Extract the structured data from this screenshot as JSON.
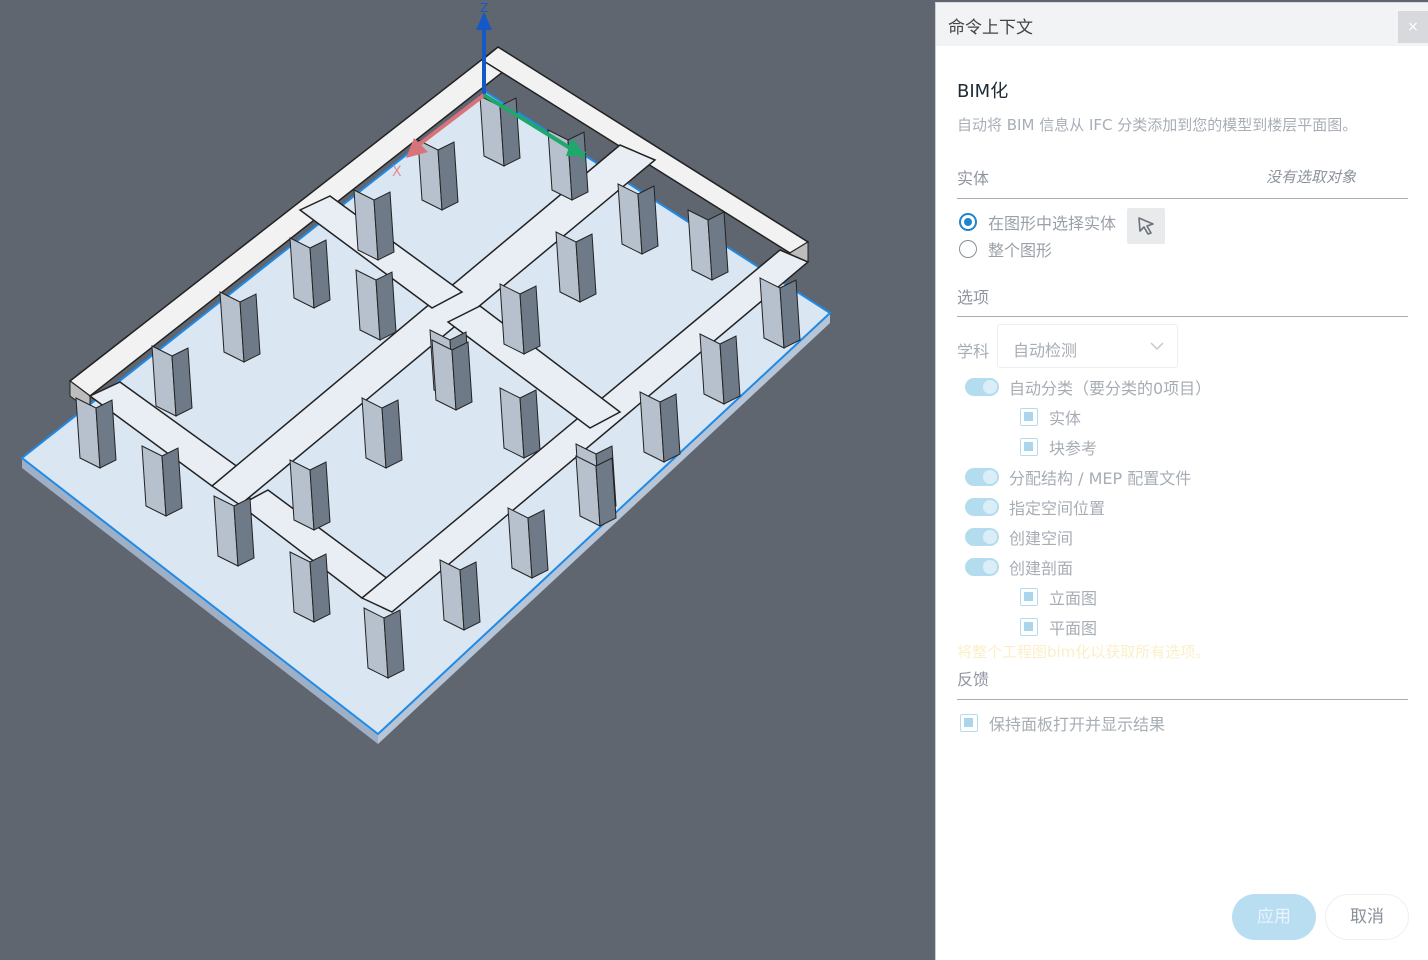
{
  "panel": {
    "header_title": "命令上下文",
    "close_label": "×",
    "title": "BIM化",
    "description": "自动将 BIM 信息从 IFC 分类添加到您的模型到楼层平面图。",
    "entities": {
      "label": "实体",
      "selection_status": "没有选取对象",
      "options": [
        {
          "label": "在图形中选择实体",
          "checked": true
        },
        {
          "label": "整个图形",
          "checked": false
        }
      ]
    },
    "options_section": {
      "label": "选项",
      "discipline_label": "学科",
      "discipline_value": "自动检测",
      "auto_classify": "自动分类（要分类的0项目）",
      "entity": "实体",
      "block_reference": "块参考",
      "assign_profile": "分配结构 / MEP 配置文件",
      "assign_space": "指定空间位置",
      "create_space": "创建空间",
      "create_section": "创建剖面",
      "elevation": "立面图",
      "plan": "平面图",
      "warning": "将整个工程图bim化以获取所有选项。"
    },
    "feedback": {
      "label": "反馈",
      "keep_open": "保持面板打开并显示结果"
    },
    "buttons": {
      "apply": "应用",
      "cancel": "取消"
    }
  },
  "viewport": {
    "axis_x": "X",
    "axis_y": "Y",
    "axis_z": "Z",
    "colors": {
      "background": "#5f6670",
      "slab": "#dbe6f3",
      "selection": "#1e8be8",
      "column": "#8c97a5"
    }
  }
}
